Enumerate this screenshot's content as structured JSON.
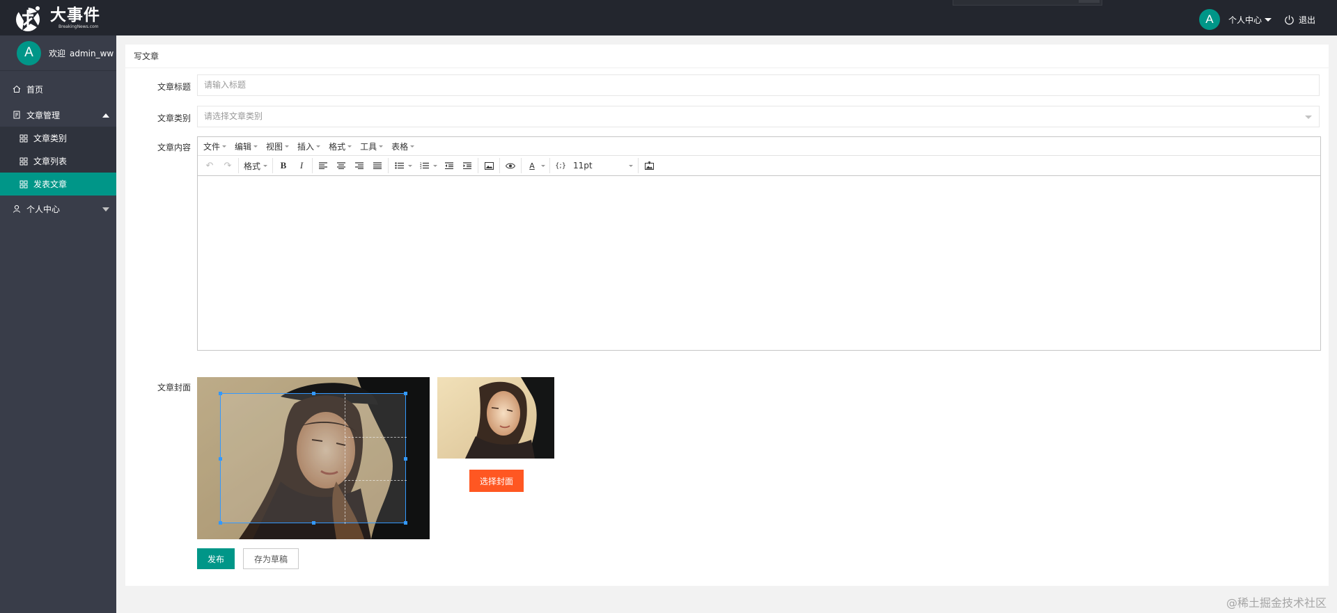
{
  "header": {
    "logo_cn": "大事件",
    "logo_en": "BreakingNews.com",
    "avatar_letter": "A",
    "user_center": "个人中心",
    "logout": "退出"
  },
  "sidebar": {
    "avatar_letter": "A",
    "welcome": "欢迎",
    "username": "admin_ww",
    "items": [
      {
        "label": "首页",
        "icon": "home-icon"
      },
      {
        "label": "文章管理",
        "icon": "article-icon",
        "expanded": true
      },
      {
        "label": "文章类别",
        "icon": "app-icon"
      },
      {
        "label": "文章列表",
        "icon": "app-icon"
      },
      {
        "label": "发表文章",
        "icon": "app-icon",
        "active": true
      },
      {
        "label": "个人中心",
        "icon": "user-icon",
        "expanded": false
      }
    ]
  },
  "main": {
    "card_title": "写文章",
    "title_label": "文章标题",
    "title_placeholder": "请输入标题",
    "category_label": "文章类别",
    "category_placeholder": "请选择文章类别",
    "content_label": "文章内容",
    "cover_label": "文章封面",
    "choose_cover": "选择封面",
    "publish": "发布",
    "save_draft": "存为草稿"
  },
  "editor": {
    "menus": [
      "文件",
      "编辑",
      "视图",
      "插入",
      "格式",
      "工具",
      "表格"
    ],
    "format_label": "格式",
    "font_size": "11pt",
    "tools": [
      "undo-icon",
      "redo-icon",
      "bold-icon",
      "italic-icon",
      "align-left-icon",
      "align-center-icon",
      "align-right-icon",
      "align-justify-icon",
      "bullet-list-icon",
      "numbered-list-icon",
      "outdent-icon",
      "indent-icon",
      "image-icon",
      "preview-icon",
      "text-color-icon",
      "code-icon",
      "upload-image-icon"
    ]
  },
  "watermark": "@稀土掘金技术社区",
  "colors": {
    "header_bg": "#23262e",
    "sidebar_bg": "#393d49",
    "accent": "#009688",
    "warm": "#ff5722"
  }
}
